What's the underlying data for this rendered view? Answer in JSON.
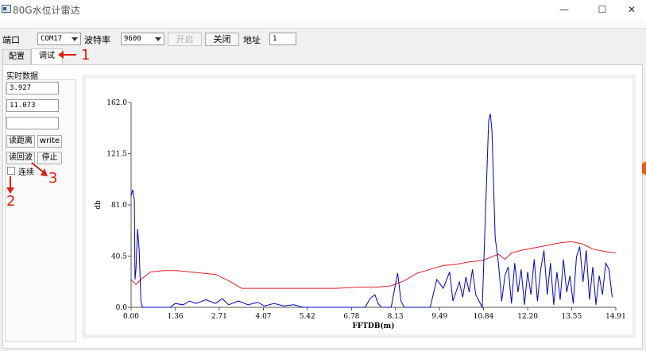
{
  "window": {
    "title": "80G水位计雷达",
    "minimize": "—",
    "maximize": "☐",
    "close": "✕"
  },
  "toolbar": {
    "port_label": "端口",
    "port_value": "COM17",
    "baud_label": "波特率",
    "baud_value": "9600",
    "open_label": "开启",
    "close_label": "关闭",
    "address_label": "地址",
    "address_value": "1"
  },
  "tabs": [
    {
      "label": "配置"
    },
    {
      "label": "调试"
    }
  ],
  "left_panel": {
    "group_label": "实时数据",
    "value1": "3.927",
    "value2": "11.073",
    "value3": "",
    "read_distance": "读距离",
    "write": "write",
    "read_echo": "读回波",
    "stop": "停止",
    "continuous": "连续"
  },
  "annotations": {
    "a1": "1",
    "a2": "2",
    "a3": "3"
  },
  "colors": {
    "blue_series": "#0000cc",
    "red_series": "#e0202a",
    "annotation": "#e02010"
  },
  "chart_data": {
    "type": "line",
    "xlabel": "FFTDB(m)",
    "ylabel": "db",
    "xlim": [
      0.0,
      14.91
    ],
    "ylim": [
      0.0,
      162.0
    ],
    "x_ticks": [
      "0.00",
      "1.36",
      "2.71",
      "4.07",
      "5.42",
      "6.78",
      "8.13",
      "9.49",
      "10.84",
      "12.20",
      "13.55",
      "14.91"
    ],
    "y_ticks": [
      "0.0",
      "40.5",
      "81.0",
      "121.5",
      "162.0"
    ],
    "series": [
      {
        "color": "#0000cc",
        "points": [
          [
            0.0,
            88
          ],
          [
            0.05,
            93
          ],
          [
            0.1,
            85
          ],
          [
            0.12,
            22
          ],
          [
            0.15,
            30
          ],
          [
            0.2,
            62
          ],
          [
            0.25,
            45
          ],
          [
            0.3,
            5
          ],
          [
            0.35,
            0
          ],
          [
            1.2,
            0
          ],
          [
            1.36,
            3
          ],
          [
            1.6,
            2
          ],
          [
            1.8,
            5
          ],
          [
            2.0,
            3
          ],
          [
            2.3,
            6
          ],
          [
            2.6,
            3
          ],
          [
            2.8,
            7
          ],
          [
            3.0,
            2
          ],
          [
            3.3,
            5
          ],
          [
            3.6,
            2
          ],
          [
            3.9,
            4
          ],
          [
            4.1,
            1
          ],
          [
            4.4,
            3
          ],
          [
            4.7,
            1
          ],
          [
            5.0,
            2
          ],
          [
            5.3,
            0
          ],
          [
            7.2,
            0
          ],
          [
            7.35,
            7
          ],
          [
            7.5,
            10
          ],
          [
            7.6,
            3
          ],
          [
            7.7,
            0
          ],
          [
            8.0,
            0
          ],
          [
            8.13,
            18
          ],
          [
            8.2,
            27
          ],
          [
            8.3,
            5
          ],
          [
            8.4,
            0
          ],
          [
            9.2,
            0
          ],
          [
            9.4,
            22
          ],
          [
            9.6,
            15
          ],
          [
            9.8,
            28
          ],
          [
            9.9,
            5
          ],
          [
            10.1,
            20
          ],
          [
            10.2,
            8
          ],
          [
            10.3,
            24
          ],
          [
            10.4,
            12
          ],
          [
            10.5,
            30
          ],
          [
            10.6,
            10
          ],
          [
            10.7,
            5
          ],
          [
            10.8,
            0
          ],
          [
            11.0,
            148
          ],
          [
            11.05,
            153
          ],
          [
            11.1,
            140
          ],
          [
            11.2,
            55
          ],
          [
            11.3,
            35
          ],
          [
            11.4,
            5
          ],
          [
            11.5,
            25
          ],
          [
            11.6,
            32
          ],
          [
            11.7,
            3
          ],
          [
            11.8,
            35
          ],
          [
            11.9,
            12
          ],
          [
            12.0,
            30
          ],
          [
            12.1,
            2
          ],
          [
            12.2,
            28
          ],
          [
            12.3,
            10
          ],
          [
            12.4,
            38
          ],
          [
            12.5,
            5
          ],
          [
            12.6,
            30
          ],
          [
            12.7,
            45
          ],
          [
            12.8,
            10
          ],
          [
            12.9,
            35
          ],
          [
            13.0,
            2
          ],
          [
            13.1,
            28
          ],
          [
            13.2,
            6
          ],
          [
            13.3,
            38
          ],
          [
            13.4,
            12
          ],
          [
            13.5,
            25
          ],
          [
            13.6,
            3
          ],
          [
            13.7,
            40
          ],
          [
            13.8,
            48
          ],
          [
            13.9,
            20
          ],
          [
            14.0,
            45
          ],
          [
            14.1,
            6
          ],
          [
            14.2,
            32
          ],
          [
            14.3,
            2
          ],
          [
            14.4,
            25
          ],
          [
            14.5,
            10
          ],
          [
            14.6,
            35
          ],
          [
            14.7,
            30
          ],
          [
            14.8,
            8
          ]
        ]
      },
      {
        "color": "#e0202a",
        "points": [
          [
            0.0,
            22
          ],
          [
            0.15,
            18
          ],
          [
            0.3,
            22
          ],
          [
            0.6,
            28
          ],
          [
            1.0,
            29
          ],
          [
            1.4,
            29
          ],
          [
            1.8,
            28
          ],
          [
            2.2,
            27
          ],
          [
            2.6,
            26
          ],
          [
            3.0,
            21
          ],
          [
            3.4,
            15
          ],
          [
            3.8,
            15
          ],
          [
            4.5,
            15
          ],
          [
            5.5,
            15
          ],
          [
            6.3,
            15
          ],
          [
            7.0,
            16
          ],
          [
            7.6,
            16
          ],
          [
            8.0,
            17
          ],
          [
            8.4,
            21
          ],
          [
            8.8,
            27
          ],
          [
            9.2,
            30
          ],
          [
            9.6,
            33
          ],
          [
            10.0,
            34
          ],
          [
            10.4,
            36
          ],
          [
            10.8,
            37
          ],
          [
            11.1,
            40
          ],
          [
            11.3,
            42
          ],
          [
            11.5,
            38
          ],
          [
            11.7,
            43
          ],
          [
            12.0,
            45
          ],
          [
            12.4,
            47
          ],
          [
            12.8,
            49
          ],
          [
            13.2,
            51
          ],
          [
            13.55,
            52
          ],
          [
            13.9,
            50
          ],
          [
            14.2,
            46
          ],
          [
            14.6,
            44
          ],
          [
            14.91,
            43
          ]
        ]
      }
    ]
  }
}
